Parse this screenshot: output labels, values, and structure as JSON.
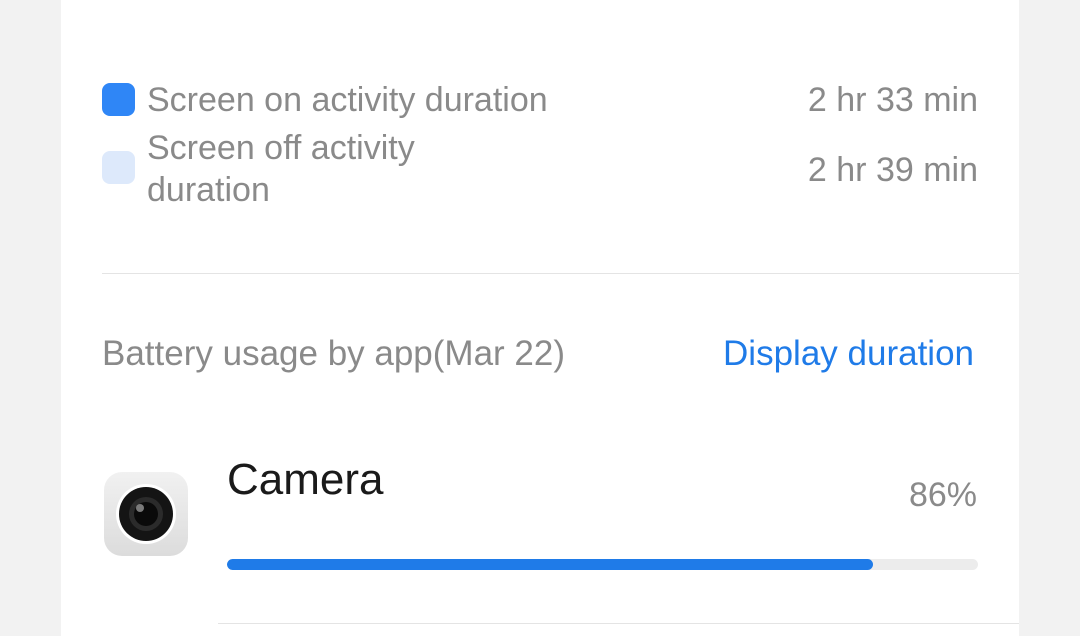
{
  "legend": {
    "items": [
      {
        "label": "Screen on activity duration",
        "value": "2 hr 33 min",
        "color": "#2f86f6"
      },
      {
        "label": "Screen off activity duration",
        "value": "2 hr 39 min",
        "color": "#dde9fb"
      }
    ]
  },
  "battery_section": {
    "title": "Battery usage by app(Mar 22)",
    "action_label": "Display duration",
    "accent_color": "#1f7be8"
  },
  "apps": [
    {
      "name": "Camera",
      "percent_label": "86%",
      "percent": 0.86,
      "icon": "camera-icon"
    }
  ]
}
